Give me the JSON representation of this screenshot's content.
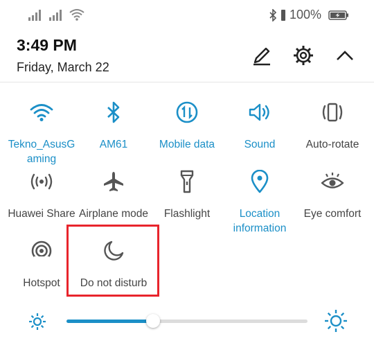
{
  "status_bar": {
    "battery_percent": "100%"
  },
  "header": {
    "time": "3:49 PM",
    "date": "Friday, March 22"
  },
  "accent_color": "#1b8fc7",
  "highlight_color": "#e8242c",
  "tiles": [
    {
      "label": "Tekno_AsusGaming",
      "icon": "wifi-icon",
      "active": true
    },
    {
      "label": "AM61",
      "icon": "bluetooth-icon",
      "active": true
    },
    {
      "label": "Mobile data",
      "icon": "mobile-data-icon",
      "active": true
    },
    {
      "label": "Sound",
      "icon": "sound-icon",
      "active": true
    },
    {
      "label": "Auto-rotate",
      "icon": "auto-rotate-icon",
      "active": false
    },
    {
      "label": "Huawei Share",
      "icon": "huawei-share-icon",
      "active": false
    },
    {
      "label": "Airplane mode",
      "icon": "airplane-icon",
      "active": false
    },
    {
      "label": "Flashlight",
      "icon": "flashlight-icon",
      "active": false
    },
    {
      "label": "Location information",
      "icon": "location-icon",
      "active": true
    },
    {
      "label": "Eye comfort",
      "icon": "eye-icon",
      "active": false
    },
    {
      "label": "Hotspot",
      "icon": "hotspot-icon",
      "active": false
    },
    {
      "label": "Do not disturb",
      "icon": "moon-icon",
      "active": false
    }
  ],
  "brightness": {
    "level": 0.36
  }
}
